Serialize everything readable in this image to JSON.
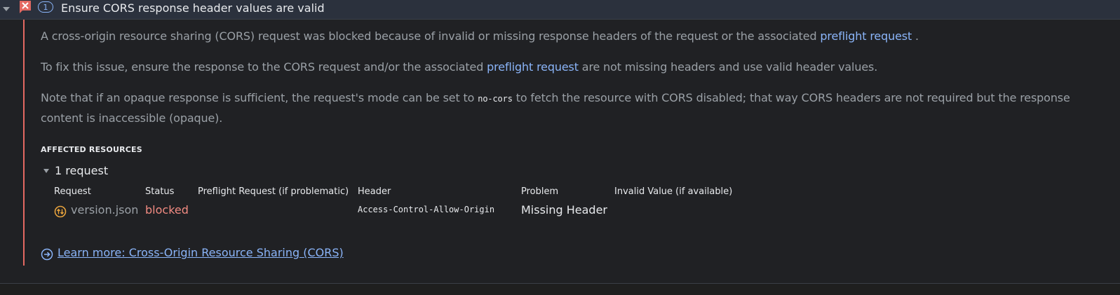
{
  "issue": {
    "count": "1",
    "title": "Ensure CORS response header values are valid"
  },
  "description": {
    "p1_text": "A cross-origin resource sharing (CORS) request was blocked because of invalid or missing response headers of the request or the associated ",
    "p1_link": "preflight request",
    "p1_tail": " .",
    "p2_text": "To fix this issue, ensure the response to the CORS request and/or the associated ",
    "p2_link": "preflight request",
    "p2_tail": " are not missing headers and use valid header values.",
    "p3_text_a": "Note that if an opaque response is sufficient, the request's mode can be set to ",
    "p3_code": "no-cors",
    "p3_text_b": " to fetch the resource with CORS disabled; that way CORS headers are not required but the response content is inaccessible (opaque)."
  },
  "affected": {
    "label": "AFFECTED RESOURCES",
    "request_count_label": "1 request",
    "columns": {
      "request": "Request",
      "status": "Status",
      "preflight": "Preflight Request (if problematic)",
      "header": "Header",
      "problem": "Problem",
      "invalid_value": "Invalid Value (if available)"
    },
    "rows": [
      {
        "request": "version.json",
        "status": "blocked",
        "header": "Access-Control-Allow-Origin",
        "problem": "Missing Header"
      }
    ]
  },
  "learn_more": {
    "label": "Learn more: Cross-Origin Resource Sharing (CORS)"
  },
  "colors": {
    "header_bg": "#2b313d",
    "page_bg": "#202124",
    "error_red": "#e46962",
    "link_blue": "#8ab4f8",
    "status_red": "#f28b82",
    "network_icon_orange": "#e8a33d"
  },
  "icons": {
    "expand": "caret-down-icon",
    "error": "error-flag-icon",
    "request_toggle": "caret-down-icon",
    "network": "network-request-icon",
    "learn_more": "circle-arrow-right-icon"
  }
}
